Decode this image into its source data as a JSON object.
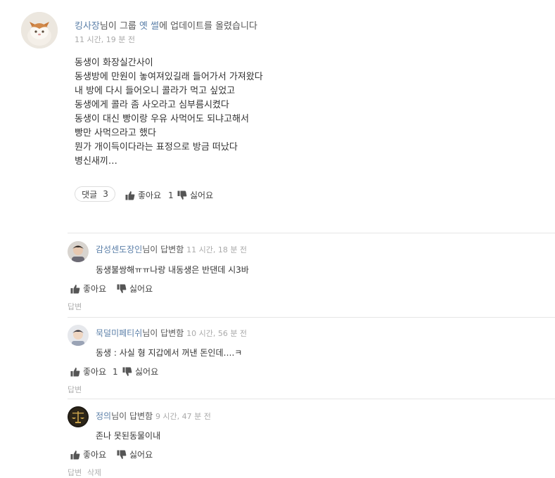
{
  "post": {
    "user": "킹사장",
    "header_suffix_1": "님이 그룹 ",
    "group": "옛 썰",
    "header_suffix_2": "에 업데이트를 올렸습니다",
    "time": "11 시간, 19 분 전",
    "lines": [
      "동생이 화장실간사이",
      "동생방에 만원이 놓여져있길래 들어가서 가져왔다",
      "내 방에 다시 들어오니 콜라가 먹고 싶었고",
      "동생에게 콜라 좀 사오라고 심부름시켰다",
      "동생이 대신 빵이랑 우유 사먹어도 되냐고해서",
      "빵만 사먹으라고 했다",
      "뭔가 개이득이다라는 표정으로 방금 떠났다",
      "병신새끼…"
    ],
    "reply_label": "댓글",
    "reply_count": "3",
    "like_label": "좋아요",
    "like_count": "1",
    "dislike_label": "싫어요"
  },
  "comments": [
    {
      "user": "감성센도장인",
      "suffix": "님이 답변함",
      "time": "11 시간, 18 분 전",
      "text": "동생불쌍해ㅠㅠ나랑 내동생은 반댄데 시3바",
      "like_label": "좋아요",
      "like_count": "",
      "dislike_label": "싫어요",
      "reply_label": "답변",
      "delete_label": ""
    },
    {
      "user": "묵덜미페티쉬",
      "suffix": "님이 답변함",
      "time": "10 시간, 56 분 전",
      "text": "동생 : 사실 형 지갑에서 꺼낸 돈인데….ㅋ",
      "like_label": "좋아요",
      "like_count": "1",
      "dislike_label": "싫어요",
      "reply_label": "답변",
      "delete_label": ""
    },
    {
      "user": "정의",
      "suffix": "님이 답변함",
      "time": "9 시간, 47 분 전",
      "text": "존나 못된동물이내",
      "like_label": "좋아요",
      "like_count": "",
      "dislike_label": "싫어요",
      "reply_label": "답변",
      "delete_label": "삭제"
    }
  ],
  "icons": {
    "thumb_up": "thumbs-up-icon",
    "thumb_down": "thumbs-down-icon"
  },
  "colors": {
    "user_link": "#5b7fa8",
    "time": "#aaaaaa",
    "divider": "#e6e6e6"
  }
}
